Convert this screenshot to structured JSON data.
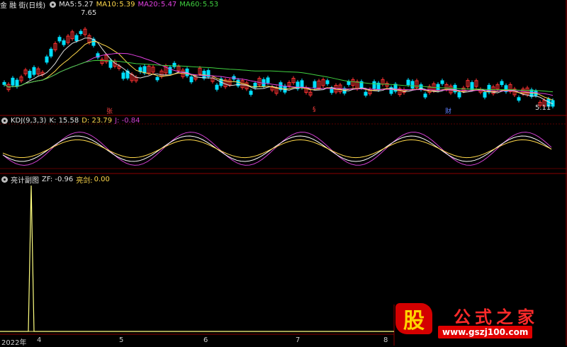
{
  "main_panel": {
    "title": "金 融 街(日线)",
    "ma": [
      {
        "label": "MA5:",
        "value": "5.27",
        "color": "#e0e0e0"
      },
      {
        "label": "MA10:",
        "value": "5.39",
        "color": "#ffd84a"
      },
      {
        "label": "MA20:",
        "value": "5.47",
        "color": "#e040e0"
      },
      {
        "label": "MA60:",
        "value": "5.53",
        "color": "#40d040"
      }
    ],
    "high_label": "7.65",
    "low_label": "5.11",
    "markers": [
      "张",
      "§",
      "财"
    ]
  },
  "kdj_panel": {
    "title": "KDJ(9,3,3)",
    "k": "K: 15.58",
    "d": "D: 23.79",
    "j": "J: -0.84"
  },
  "sub_panel": {
    "title": "亮计副图",
    "zf": "ZF: -0.96",
    "lj_label": "亮剑:",
    "lj_value": "0.00"
  },
  "x_axis": {
    "labels": [
      "2022年",
      "4",
      "5",
      "6",
      "7",
      "8"
    ]
  },
  "logo": {
    "mark": "股",
    "title": "公式之家",
    "url": "www.gszj100.com"
  },
  "colors": {
    "up": "#ff3232",
    "down": "#00e0ff",
    "grid": "#7a0000",
    "kline": "#ffffff",
    "dline": "#ffd84a",
    "jline": "#d040d0",
    "zf": "#ffff80"
  }
}
